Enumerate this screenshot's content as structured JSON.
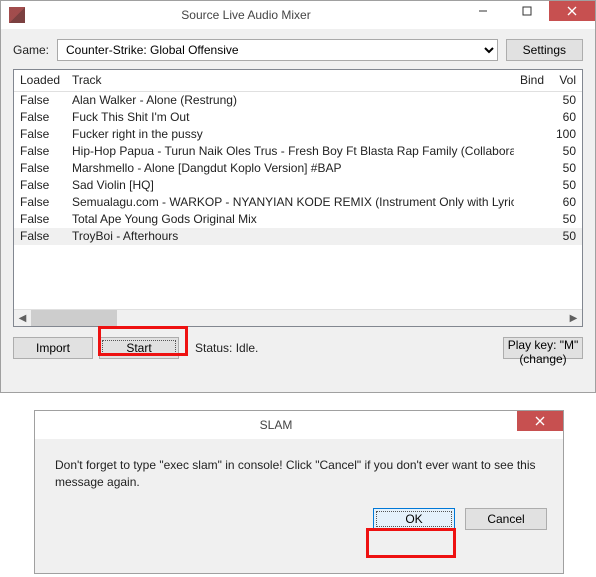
{
  "main": {
    "title": "Source Live Audio Mixer",
    "game_label": "Game:",
    "game_value": "Counter-Strike: Global Offensive",
    "settings_label": "Settings",
    "columns": {
      "loaded": "Loaded",
      "track": "Track",
      "bind": "Bind",
      "vol": "Vol"
    },
    "rows": [
      {
        "loaded": "False",
        "track": "Alan Walker - Alone (Restrung)",
        "bind": "",
        "vol": "50"
      },
      {
        "loaded": "False",
        "track": "Fuck This Shit I'm Out",
        "bind": "",
        "vol": "60"
      },
      {
        "loaded": "False",
        "track": "Fucker right in the pussy",
        "bind": "",
        "vol": "100"
      },
      {
        "loaded": "False",
        "track": "Hip-Hop Papua - Turun Naik Oles Trus - Fresh Boy Ft Blasta Rap Family (Collaboration) Lyrics",
        "bind": "",
        "vol": "50"
      },
      {
        "loaded": "False",
        "track": "Marshmello - Alone [Dangdut Koplo Version] #BAP",
        "bind": "",
        "vol": "50"
      },
      {
        "loaded": "False",
        "track": "Sad Violin [HQ]",
        "bind": "",
        "vol": "50"
      },
      {
        "loaded": "False",
        "track": "Semualagu.com - WARKOP - NYANYIAN KODE REMIX (Instrument Only with Lyric)",
        "bind": "",
        "vol": "60"
      },
      {
        "loaded": "False",
        "track": "Total Ape   Young Gods Original Mix",
        "bind": "",
        "vol": "50"
      },
      {
        "loaded": "False",
        "track": "TroyBoi - Afterhours",
        "bind": "",
        "vol": "50"
      }
    ],
    "import_label": "Import",
    "start_label": "Start",
    "status_text": "Status: Idle.",
    "playkey_label": "Play key: \"M\" (change)"
  },
  "dialog": {
    "title": "SLAM",
    "message": "Don't forget to type \"exec slam\" in console! Click \"Cancel\" if you don't ever want to see this message again.",
    "ok_label": "OK",
    "cancel_label": "Cancel"
  }
}
